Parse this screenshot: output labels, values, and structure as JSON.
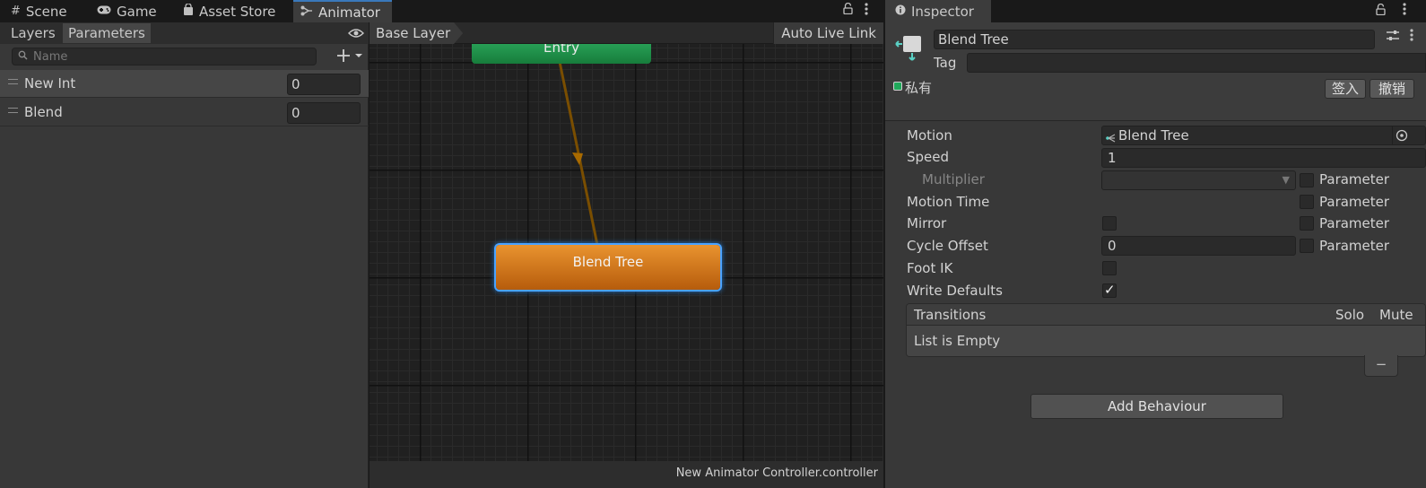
{
  "left_tabs": [
    {
      "label": "Scene",
      "icon": "grid-icon"
    },
    {
      "label": "Game",
      "icon": "gamepad-icon"
    },
    {
      "label": "Asset Store",
      "icon": "bag-icon"
    },
    {
      "label": "Animator",
      "icon": "animator-icon"
    }
  ],
  "params_panel": {
    "layers_tab": "Layers",
    "parameters_tab": "Parameters",
    "search_placeholder": "Name",
    "parameters": [
      {
        "name": "New Int",
        "value": "0"
      },
      {
        "name": "Blend",
        "value": "0"
      }
    ]
  },
  "graph": {
    "breadcrumb": "Base Layer",
    "auto_live_link": "Auto Live Link",
    "entry_node": "Entry",
    "blend_node": "Blend Tree",
    "controller_file": "New Animator Controller.controller"
  },
  "inspector": {
    "tab_title": "Inspector",
    "name_value": "Blend Tree",
    "tag_label": "Tag",
    "private_label": "私有",
    "checkin_button": "签入",
    "undo_button": "撤销",
    "motion_label": "Motion",
    "motion_value": "Blend Tree",
    "speed_label": "Speed",
    "speed_value": "1",
    "multiplier_label": "Multiplier",
    "motion_time_label": "Motion Time",
    "mirror_label": "Mirror",
    "cycle_offset_label": "Cycle Offset",
    "cycle_offset_value": "0",
    "foot_ik_label": "Foot IK",
    "write_defaults_label": "Write Defaults",
    "parameter_label": "Parameter",
    "transitions_label": "Transitions",
    "solo_label": "Solo",
    "mute_label": "Mute",
    "list_empty": "List is Empty",
    "minus_symbol": "−",
    "add_behaviour": "Add Behaviour",
    "write_defaults_checked": true,
    "private_checked": true
  },
  "colors": {
    "accent": "#3a79bb",
    "entry_node": "#1f8f47",
    "state_node": "#d3781e",
    "selection_glow": "#4aa3ff",
    "transition_arrow": "#8a5a00"
  }
}
